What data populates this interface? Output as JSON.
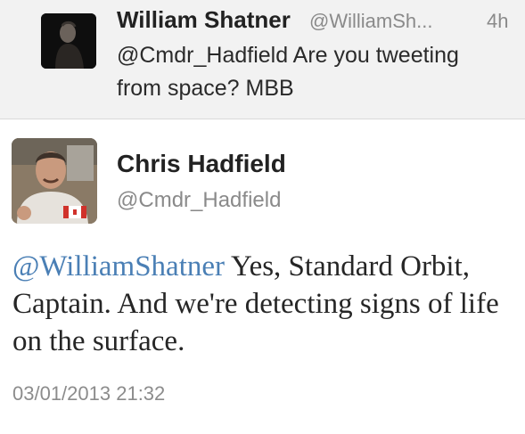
{
  "reply_context": {
    "author_name": "William Shatner",
    "author_handle": "@WilliamSh...",
    "time_ago": "4h",
    "text": "@Cmdr_Hadfield Are you tweeting from space? MBB"
  },
  "tweet": {
    "author_name": "Chris Hadfield",
    "author_handle": "@Cmdr_Hadfield",
    "mention": "@WilliamShatner",
    "text": " Yes, Standard Orbit, Captain. And we're detecting signs of life on the surface.",
    "timestamp": "03/01/2013 21:32"
  },
  "colors": {
    "mention": "#4a7fb5",
    "context_background": "#f2f2f2",
    "muted_text": "#8a8a8a"
  }
}
